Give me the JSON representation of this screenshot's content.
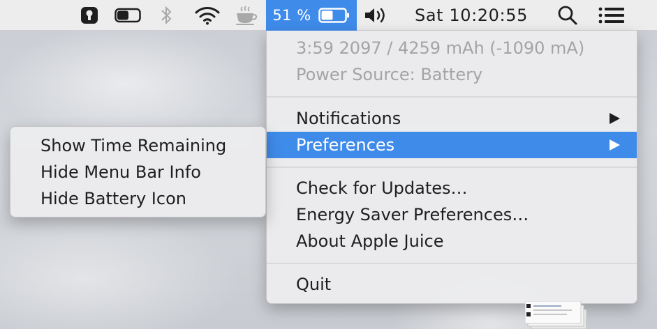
{
  "menubar": {
    "icons": [
      "keyhole-icon",
      "toggle-icon",
      "bluetooth-icon",
      "wifi-icon",
      "coffee-cup-icon",
      "battery-icon",
      "volume-icon",
      "search-icon",
      "list-icon"
    ],
    "battery_percent": "51 %",
    "battery_level": 0.51,
    "clock": "Sat 10:20:55",
    "active_color": "#3f8bea"
  },
  "menu": {
    "info_line": "3:59 2097 / 4259 mAh (-1090 mA)",
    "power_source": "Power Source: Battery",
    "items": [
      {
        "label": "Notifications",
        "has_submenu": true
      },
      {
        "label": "Preferences",
        "has_submenu": true,
        "highlighted": true
      },
      {
        "label": "Check for Updates…"
      },
      {
        "label": "Energy Saver Preferences…"
      },
      {
        "label": "About Apple Juice"
      },
      {
        "label": "Quit"
      }
    ]
  },
  "submenu": {
    "items": [
      {
        "label": "Show Time Remaining"
      },
      {
        "label": "Hide Menu Bar Info"
      },
      {
        "label": "Hide Battery Icon"
      }
    ]
  }
}
